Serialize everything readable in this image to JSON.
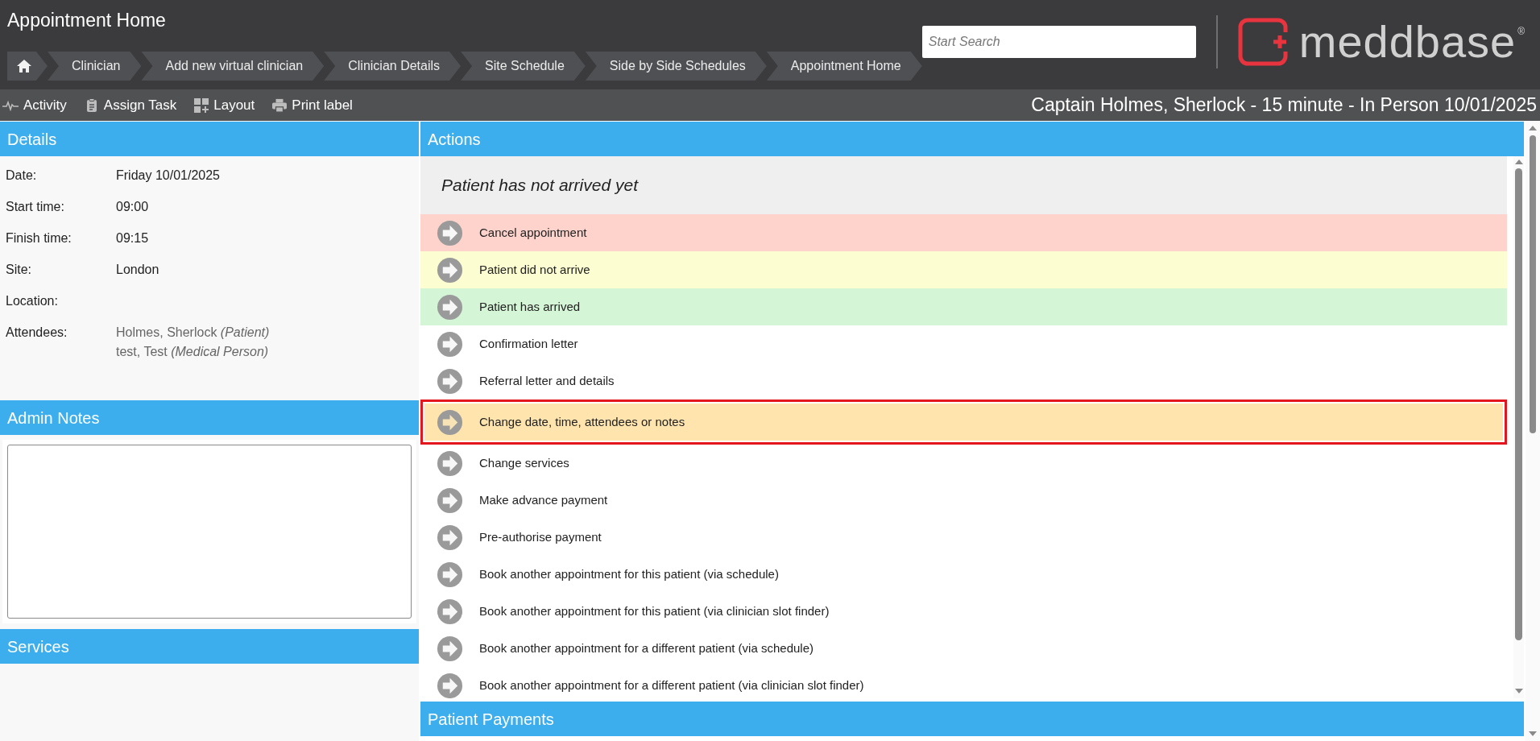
{
  "page_title": "Appointment Home",
  "breadcrumbs": [
    {
      "label": "Clinician"
    },
    {
      "label": "Add new virtual clinician"
    },
    {
      "label": "Clinician Details"
    },
    {
      "label": "Site Schedule"
    },
    {
      "label": "Side by Side Schedules"
    },
    {
      "label": "Appointment Home"
    }
  ],
  "search": {
    "placeholder": "Start Search"
  },
  "logo": {
    "text": "meddbase",
    "mark": "®"
  },
  "toolbar": [
    {
      "kind": "activity",
      "label": "Activity"
    },
    {
      "kind": "task",
      "label": "Assign Task"
    },
    {
      "kind": "layout",
      "label": "Layout"
    },
    {
      "kind": "print",
      "label": "Print label"
    }
  ],
  "appointment_title": "Captain Holmes, Sherlock - 15 minute - In Person 10/01/2025",
  "details": {
    "title": "Details",
    "fields": [
      {
        "label": "Date:",
        "values": [
          "Friday 10/01/2025"
        ]
      },
      {
        "label": "Start time:",
        "values": [
          "09:00"
        ]
      },
      {
        "label": "Finish time:",
        "values": [
          "09:15"
        ]
      },
      {
        "label": "Site:",
        "values": [
          "London"
        ]
      },
      {
        "label": "Location:"
      },
      {
        "label": "Attendees:",
        "kind": "people",
        "values": [
          "Holmes, Sherlock *(Patient)*",
          "test, Test *(Medical Person)*"
        ]
      }
    ]
  },
  "admin_notes": {
    "title": "Admin Notes"
  },
  "services": {
    "title": "Services"
  },
  "actions": {
    "title": "Actions",
    "status": "Patient has not arrived yet",
    "items": [
      {
        "label": "Cancel appointment",
        "color": "#fed3cc",
        "selected": false
      },
      {
        "label": "Patient did not arrive",
        "color": "#fdfdd2",
        "selected": false
      },
      {
        "label": "Patient has arrived",
        "color": "#d5f5d7",
        "selected": false
      },
      {
        "label": "Confirmation letter",
        "selected": false
      },
      {
        "label": "Referral letter and details",
        "selected": false
      },
      {
        "label": "Change date, time, attendees or notes",
        "selected": true
      },
      {
        "label": "Change services",
        "selected": false
      },
      {
        "label": "Make advance payment",
        "selected": false
      },
      {
        "label": "Pre-authorise payment",
        "selected": false
      },
      {
        "label": "Book another appointment for this patient (via schedule)",
        "selected": false
      },
      {
        "label": "Book another appointment for this patient (via clinician slot finder)",
        "selected": false
      },
      {
        "label": "Book another appointment for a different patient (via schedule)",
        "selected": false
      },
      {
        "label": "Book another appointment for a different patient (via clinician slot finder)",
        "selected": false
      }
    ]
  },
  "patient_payments": {
    "title": "Patient Payments"
  }
}
